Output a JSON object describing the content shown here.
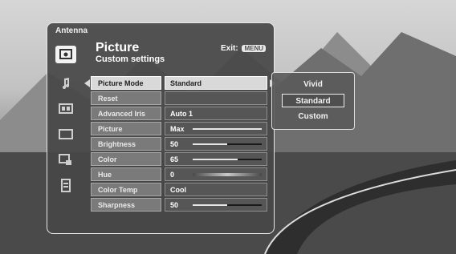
{
  "source_label": "Antenna",
  "header": {
    "title": "Picture",
    "subtitle": "Custom settings",
    "exit_label": "Exit:",
    "exit_key": "MENU"
  },
  "side_icons": [
    "picture-icon",
    "sound-icon",
    "channel-icon",
    "screen-icon",
    "lock-icon",
    "setup-icon"
  ],
  "settings": [
    {
      "label": "Picture Mode",
      "value": "Standard"
    },
    {
      "label": "Reset",
      "value": ""
    },
    {
      "label": "Advanced Iris",
      "value": "Auto 1"
    },
    {
      "label": "Picture",
      "value": "Max",
      "level": 1.0
    },
    {
      "label": "Brightness",
      "value": "50",
      "level": 0.5
    },
    {
      "label": "Color",
      "value": "65",
      "level": 0.65
    },
    {
      "label": "Hue",
      "value": "0"
    },
    {
      "label": "Color Temp",
      "value": "Cool"
    },
    {
      "label": "Sharpness",
      "value": "50",
      "level": 0.5
    }
  ],
  "options": [
    "Vivid",
    "Standard",
    "Custom"
  ],
  "selected_option": "Standard"
}
